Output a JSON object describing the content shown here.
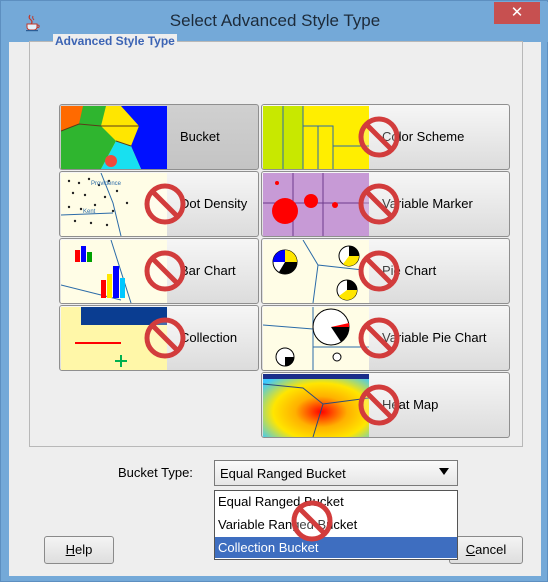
{
  "window": {
    "title": "Select Advanced Style Type",
    "close_glyph": "✕"
  },
  "group": {
    "label": "Advanced Style Type"
  },
  "tiles": [
    {
      "label": "Bucket",
      "icon": "bucket-thumbnail",
      "selected": true,
      "disabled": false
    },
    {
      "label": "Color Scheme",
      "icon": "color-scheme-thumbnail",
      "selected": false,
      "disabled": true
    },
    {
      "label": "Dot Density",
      "icon": "dot-density-thumbnail",
      "selected": false,
      "disabled": true
    },
    {
      "label": "Variable Marker",
      "icon": "variable-marker-thumbnail",
      "selected": false,
      "disabled": true
    },
    {
      "label": "Bar Chart",
      "icon": "bar-chart-thumbnail",
      "selected": false,
      "disabled": true
    },
    {
      "label": "Pie Chart",
      "icon": "pie-chart-thumbnail",
      "selected": false,
      "disabled": true
    },
    {
      "label": "Collection",
      "icon": "collection-thumbnail",
      "selected": false,
      "disabled": true
    },
    {
      "label": "Variable Pie Chart",
      "icon": "variable-pie-chart-thumbnail",
      "selected": false,
      "disabled": true
    },
    {
      "label": "Heat Map",
      "icon": "heat-map-thumbnail",
      "selected": false,
      "disabled": true
    }
  ],
  "thumb_text": {
    "dot_density_place_1": "Providence",
    "dot_density_place_2": "Kent"
  },
  "bucket_type": {
    "label": "Bucket Type:",
    "value": "Equal Ranged Bucket",
    "options": [
      "Equal Ranged Bucket",
      "Variable Ranged Bucket",
      "Collection Bucket"
    ],
    "highlighted": "Collection Bucket"
  },
  "buttons": {
    "help_mnemonic": "H",
    "help_rest": "elp",
    "cancel_mnemonic": "C",
    "cancel_rest": "ancel"
  },
  "colors": {
    "title_bar": "#74a9d8",
    "close_button": "#c75050",
    "group_label": "#3c64b4",
    "highlight": "#3e6ec0",
    "no_sign": "#d23c3c"
  }
}
